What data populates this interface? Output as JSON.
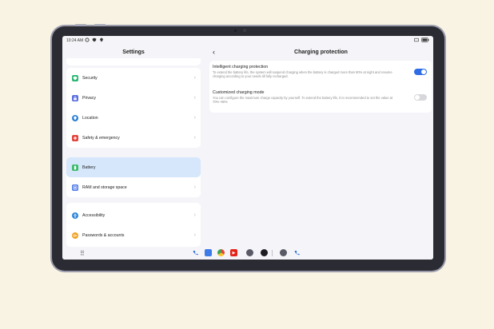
{
  "status_bar": {
    "time": "10:24 AM"
  },
  "left_pane": {
    "title": "Settings",
    "groups": [
      {
        "items": [
          {
            "label": "Security",
            "icon": "security-shield-icon",
            "color": "#2bb673"
          },
          {
            "label": "Privacy",
            "icon": "privacy-lock-icon",
            "color": "#5b6ee0"
          },
          {
            "label": "Location",
            "icon": "location-pin-icon",
            "color": "#2b7fd6"
          },
          {
            "label": "Safety & emergency",
            "icon": "safety-icon",
            "color": "#e2443b"
          }
        ]
      },
      {
        "items": [
          {
            "label": "Battery",
            "icon": "battery-icon",
            "color": "#3cbb6a",
            "active": true
          },
          {
            "label": "RAM and storage space",
            "icon": "storage-icon",
            "color": "#4f7be6"
          }
        ]
      },
      {
        "items": [
          {
            "label": "Accessibility",
            "icon": "accessibility-icon",
            "color": "#2f86d8"
          },
          {
            "label": "Passwords & accounts",
            "icon": "passwords-key-icon",
            "color": "#f0a124"
          }
        ]
      }
    ]
  },
  "right_pane": {
    "title": "Charging protection",
    "settings": [
      {
        "title": "Intelligent charging protection",
        "description": "To extend the battery life, the system will suspend charging when the battery is charged more than 80% at night and resume charging according to your needs till fully recharged.",
        "enabled": true
      },
      {
        "title": "Customized charging mode",
        "description": "You can configure the maximum charge capacity by yourself. To extend the battery life, it is recommended to set the value at 70%~90%",
        "enabled": false
      }
    ]
  },
  "dock": {
    "apps": [
      {
        "name": "phone-app-icon",
        "color": "#2c6fd8"
      },
      {
        "name": "messages-app-icon",
        "color": "#3d7be8"
      },
      {
        "name": "chrome-app-icon",
        "color": "#e8453c"
      },
      {
        "name": "youtube-app-icon",
        "color": "#e62117"
      },
      {
        "name": "camera-app-icon",
        "color": "#5a5a66"
      },
      {
        "name": "gallery-app-icon",
        "color": "#1c1c22"
      },
      {
        "name": "recent-camera-app-icon",
        "color": "#5a5a66"
      },
      {
        "name": "recent-phone-app-icon",
        "color": "#2c6fd8"
      }
    ]
  }
}
